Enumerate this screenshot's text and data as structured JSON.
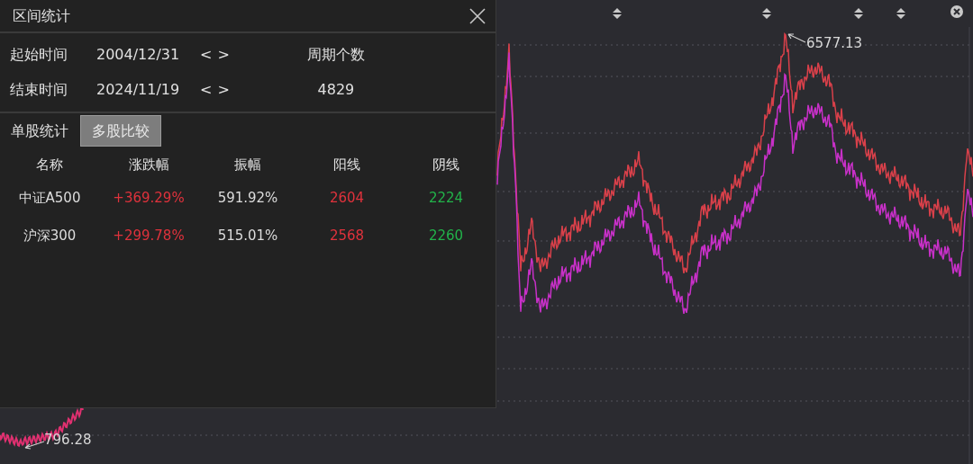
{
  "dialog": {
    "title": "区间统计",
    "fields": [
      {
        "label": "起始时间",
        "value": "2004/12/31",
        "prev": "<",
        "next": ">"
      },
      {
        "label": "结束时间",
        "value": "2024/11/19",
        "prev": "<",
        "next": ">"
      }
    ],
    "period": {
      "label": "周期个数",
      "value": "4829"
    },
    "tabs": [
      {
        "label": "单股统计",
        "selected": false
      },
      {
        "label": "多股比较",
        "selected": true
      }
    ],
    "table": {
      "columns": [
        "名称",
        "涨跌幅",
        "振幅",
        "阳线",
        "阴线"
      ],
      "rows": [
        {
          "name": "中证A500",
          "change": "+369.29%",
          "amplitude": "591.92%",
          "up": "2604",
          "down": "2224"
        },
        {
          "name": "沪深300",
          "change": "+299.78%",
          "amplitude": "515.01%",
          "up": "2568",
          "down": "2260"
        }
      ]
    }
  },
  "chart": {
    "high_label": "6577.13",
    "low_label": "796.28"
  }
}
